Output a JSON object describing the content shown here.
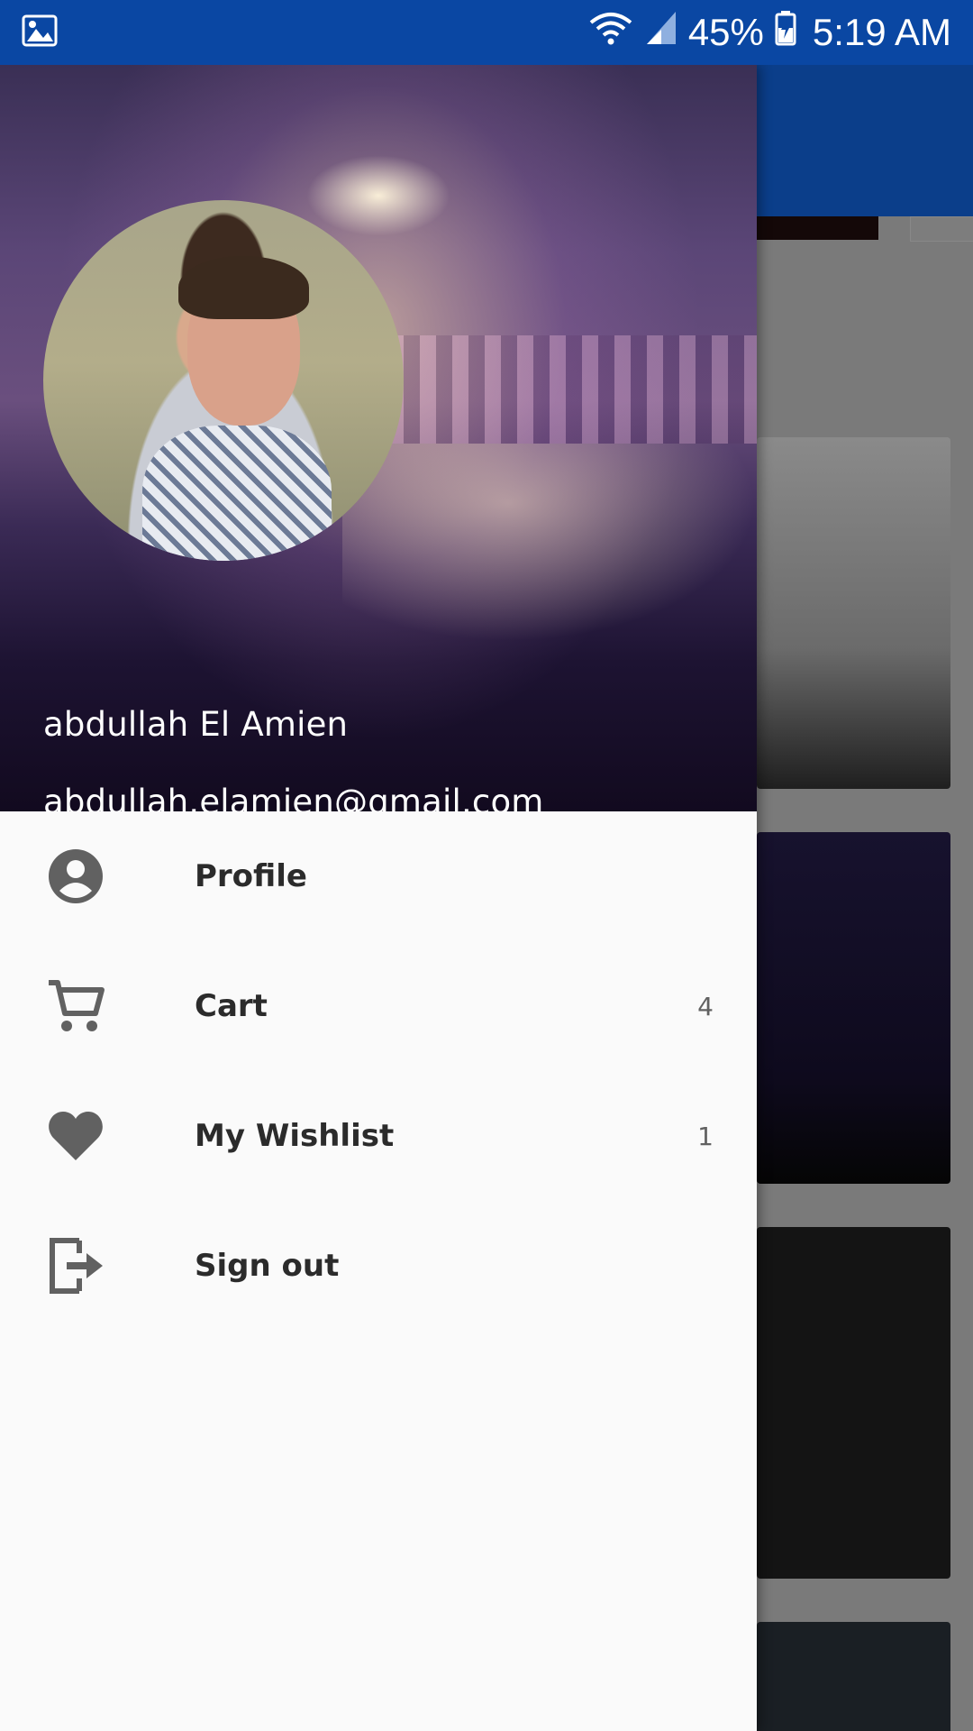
{
  "status_bar": {
    "battery": "45%",
    "time": "5:19 AM",
    "icons": [
      "image-icon",
      "wifi-icon",
      "signal-icon",
      "battery-icon"
    ]
  },
  "drawer": {
    "user_name": "abdullah El Amien",
    "user_email": "abdullah.elamien@gmail.com",
    "items": [
      {
        "label": "Profile",
        "icon": "account-circle-icon",
        "count": ""
      },
      {
        "label": "Cart",
        "icon": "cart-icon",
        "count": "4"
      },
      {
        "label": "My Wishlist",
        "icon": "heart-icon",
        "count": "1"
      },
      {
        "label": "Sign out",
        "icon": "sign-out-icon",
        "count": ""
      }
    ]
  },
  "colors": {
    "status_bar": "#0a47a3",
    "toolbar": "#0b3e8a",
    "drawer_bg": "#fafafa",
    "icon": "#616161",
    "label": "#2b2b2b"
  }
}
